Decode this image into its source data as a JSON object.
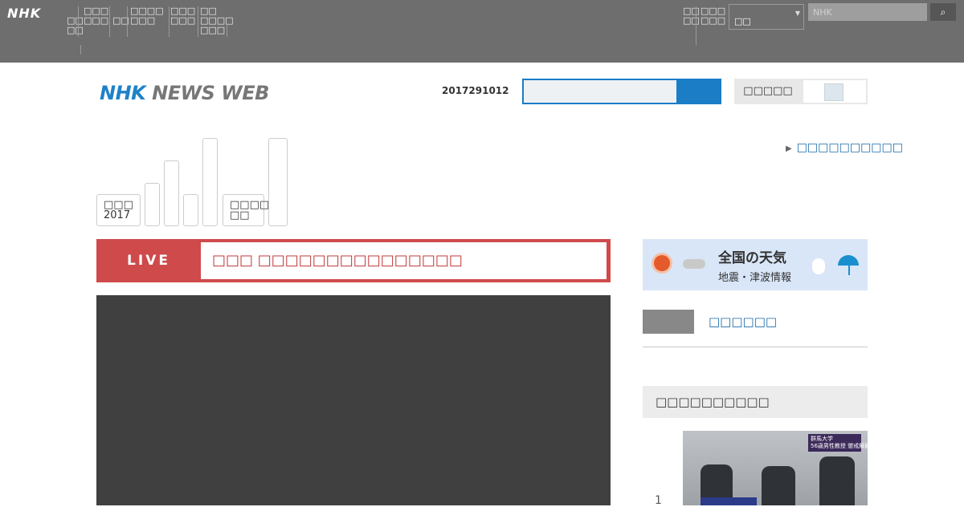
{
  "global_nav": {
    "brand": "NHK",
    "items": [
      {
        "label": "□□\n□□"
      },
      {
        "label": "□□□\n□□□"
      },
      {
        "label": "□□"
      },
      {
        "label": "□□□□\n□□□"
      },
      {
        "label": "□□□\n□□□"
      },
      {
        "label": "□□\n□□□□\n□□□"
      }
    ],
    "right_items": [
      {
        "label": "□□\n□□"
      },
      {
        "label": "□□□\n□□□"
      }
    ],
    "select_value": "□□",
    "search_placeholder": "NHK",
    "search_button": "🔍"
  },
  "header": {
    "logo_nhk": "NHK",
    "logo_rest": "NEWS WEB",
    "date": "2017291012",
    "button_a": "□□□□□"
  },
  "tabs": [
    {
      "label": "□□□\n2017"
    },
    {
      "label": ""
    },
    {
      "label": ""
    },
    {
      "label": ""
    },
    {
      "label": ""
    },
    {
      "label": "□□□□\n□□"
    },
    {
      "label": ""
    }
  ],
  "right_link": "□□□□□□□□□□",
  "live": {
    "label": "LIVE",
    "text": "□□□ □□□□□□□□□□□□□□□"
  },
  "weather": {
    "title": "全国の天気",
    "subtitle": "地震・津波情報"
  },
  "side_link": "□□□□□□",
  "ranking": {
    "heading": "□□□□□□□□□□",
    "first_rank": "1",
    "first_caption": "群馬大学\n56歳男性教授 懲戒解雇"
  },
  "colors": {
    "topbar": "#6e6e6e",
    "brand_blue": "#1f82c6",
    "live_red": "#cf4a4b",
    "link_blue": "#1a6aa8"
  }
}
